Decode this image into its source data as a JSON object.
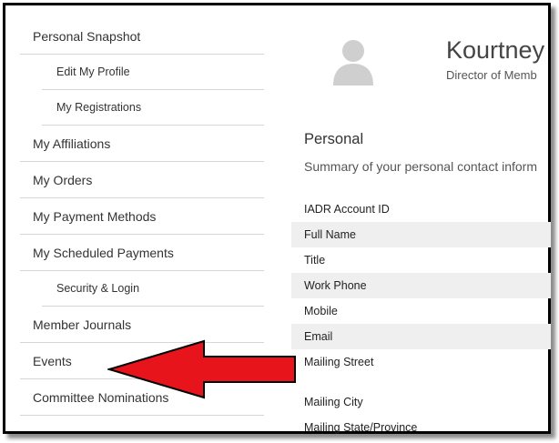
{
  "sidebar": {
    "items": [
      {
        "label": "Personal Snapshot",
        "sub": false
      },
      {
        "label": "Edit My Profile",
        "sub": true
      },
      {
        "label": "My Registrations",
        "sub": true
      },
      {
        "label": "My Affiliations",
        "sub": false
      },
      {
        "label": "My Orders",
        "sub": false
      },
      {
        "label": "My Payment Methods",
        "sub": false
      },
      {
        "label": "My Scheduled Payments",
        "sub": false
      },
      {
        "label": "Security & Login",
        "sub": true
      },
      {
        "label": "Member Journals",
        "sub": false
      },
      {
        "label": "Events",
        "sub": false
      },
      {
        "label": "Committee Nominations",
        "sub": false
      }
    ]
  },
  "profile": {
    "name": "Kourtney",
    "title": "Director of Memb",
    "avatar_icon": "user-silhouette-icon"
  },
  "personal": {
    "title": "Personal",
    "description": "Summary of your personal contact inform",
    "fields": [
      {
        "label": "IADR Account ID",
        "shaded": false,
        "tall": false
      },
      {
        "label": "Full Name",
        "shaded": true,
        "tall": false
      },
      {
        "label": "Title",
        "shaded": false,
        "tall": false
      },
      {
        "label": "Work Phone",
        "shaded": true,
        "tall": false
      },
      {
        "label": "Mobile",
        "shaded": false,
        "tall": false
      },
      {
        "label": "Email",
        "shaded": true,
        "tall": false
      },
      {
        "label": "Mailing Street",
        "shaded": false,
        "tall": true
      },
      {
        "label": "Mailing City",
        "shaded": false,
        "tall": false
      },
      {
        "label": "Mailing State/Province",
        "shaded": false,
        "tall": false
      }
    ]
  },
  "annotation": {
    "arrow_icon": "red-arrow-left-icon",
    "arrow_color": "#e8141c"
  }
}
